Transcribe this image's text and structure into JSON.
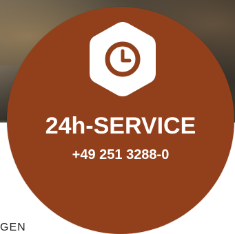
{
  "badge": {
    "title": "24h-SERVICE",
    "phone": "+49 251 3288-0",
    "icon": "clock-icon",
    "color": "#92401c"
  },
  "below_text": "GEN"
}
